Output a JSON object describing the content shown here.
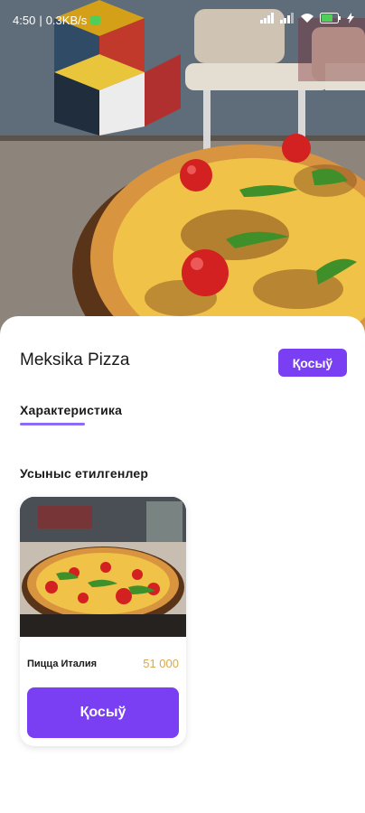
{
  "status_bar": {
    "time": "4:50",
    "speed": "0.3KB/s",
    "icons": [
      "signal-icon",
      "signal-icon",
      "wifi-icon",
      "battery-icon",
      "charging-icon"
    ]
  },
  "product": {
    "title": "Meksika Pizza",
    "add_label": "Қосыў"
  },
  "tabs": [
    {
      "label": "Характеристика",
      "active": true
    }
  ],
  "recommended": {
    "title": "Усыныс етилгенлер",
    "items": [
      {
        "name": "Пицца Италия",
        "price": "51 000",
        "add_label": "Қосыў"
      }
    ]
  },
  "colors": {
    "accent": "#7a3ff2",
    "tab_underline": "#8c6cf4",
    "price": "#d6a94f"
  }
}
